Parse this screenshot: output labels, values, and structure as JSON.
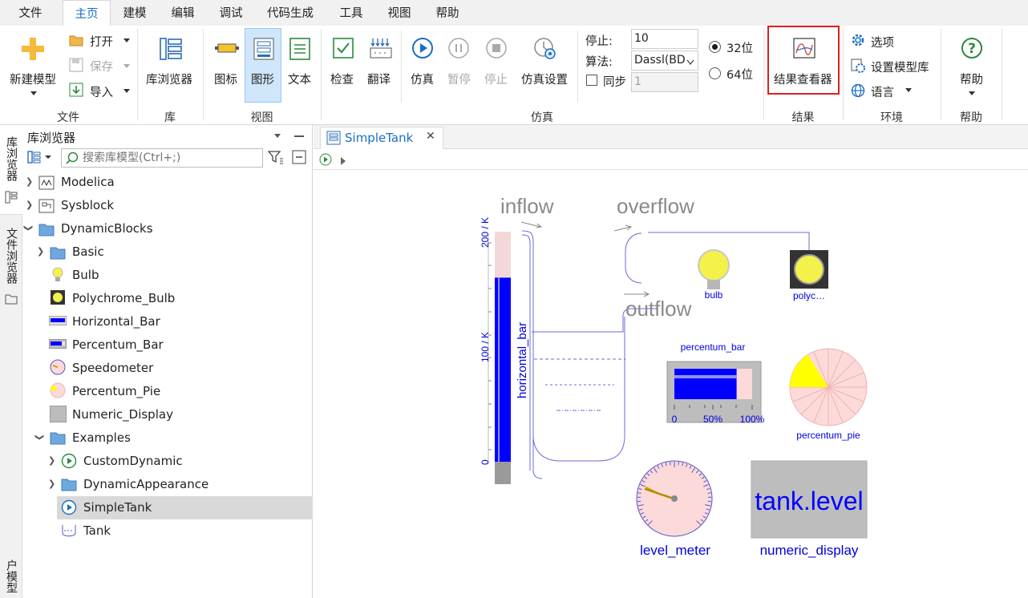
{
  "menu": [
    "文件",
    "主页",
    "建模",
    "编辑",
    "调试",
    "代码生成",
    "工具",
    "视图",
    "帮助"
  ],
  "ribbon": {
    "file": {
      "new": "新建模型",
      "open": "打开",
      "save": "保存",
      "import": "导入",
      "group": "文件"
    },
    "lib": {
      "browser": "库浏览器",
      "group": "库"
    },
    "view": {
      "icon": "图标",
      "diagram": "图形",
      "text": "文本",
      "group": "视图"
    },
    "sim": {
      "check": "检查",
      "translate": "翻译",
      "simulate": "仿真",
      "pause": "暂停",
      "stop": "停止",
      "settings": "仿真设置",
      "stop_label": "停止:",
      "stop_value": "10",
      "algo_label": "算法:",
      "algo_value": "Dassl(BD",
      "sync_label": "同步",
      "sync_value": "1",
      "bits32": "32位",
      "bits64": "64位",
      "group": "仿真"
    },
    "result": {
      "viewer": "结果查看器",
      "group": "结果"
    },
    "env": {
      "options": "选项",
      "model_lib": "设置模型库",
      "language": "语言",
      "group": "环境"
    },
    "help": {
      "help": "帮助",
      "group": "帮助"
    }
  },
  "side_tabs": {
    "library": "库浏览器",
    "file": "文件浏览器",
    "user": "户模型"
  },
  "browser": {
    "title": "库浏览器",
    "search_placeholder": "搜索库模型(Ctrl+;)",
    "items": [
      "Modelica",
      "Sysblock",
      "DynamicBlocks",
      "Basic",
      "Bulb",
      "Polychrome_Bulb",
      "Horizontal_Bar",
      "Percentum_Bar",
      "Speedometer",
      "Percentum_Pie",
      "Numeric_Display",
      "Examples",
      "CustomDynamic",
      "DynamicAppearance",
      "SimpleTank",
      "Tank"
    ]
  },
  "editor": {
    "tab": "SimpleTank"
  },
  "diagram": {
    "inflow": "inflow",
    "overflow": "overflow",
    "outflow": "outflow",
    "vbar_top": "200 / K",
    "vbar_mid": "100 / K",
    "vbar_zero": "0",
    "horizontal_bar": "horizontal_bar",
    "bulb": "bulb",
    "polyc": "polyc…",
    "percentum_bar": "percentum_bar",
    "pb_ticks": [
      "0",
      "50%",
      "100%"
    ],
    "percentum_pie": "percentum_pie",
    "level_meter": "level_meter",
    "numeric_display": "numeric_display",
    "tank_level": "tank.level",
    "vbar_level": 0.8,
    "pbar_level": 0.8,
    "pie_fraction": 0.16
  },
  "colors": {
    "accent": "#1a6fc4",
    "highlight": "#e02020",
    "bar": "#0000ff"
  }
}
